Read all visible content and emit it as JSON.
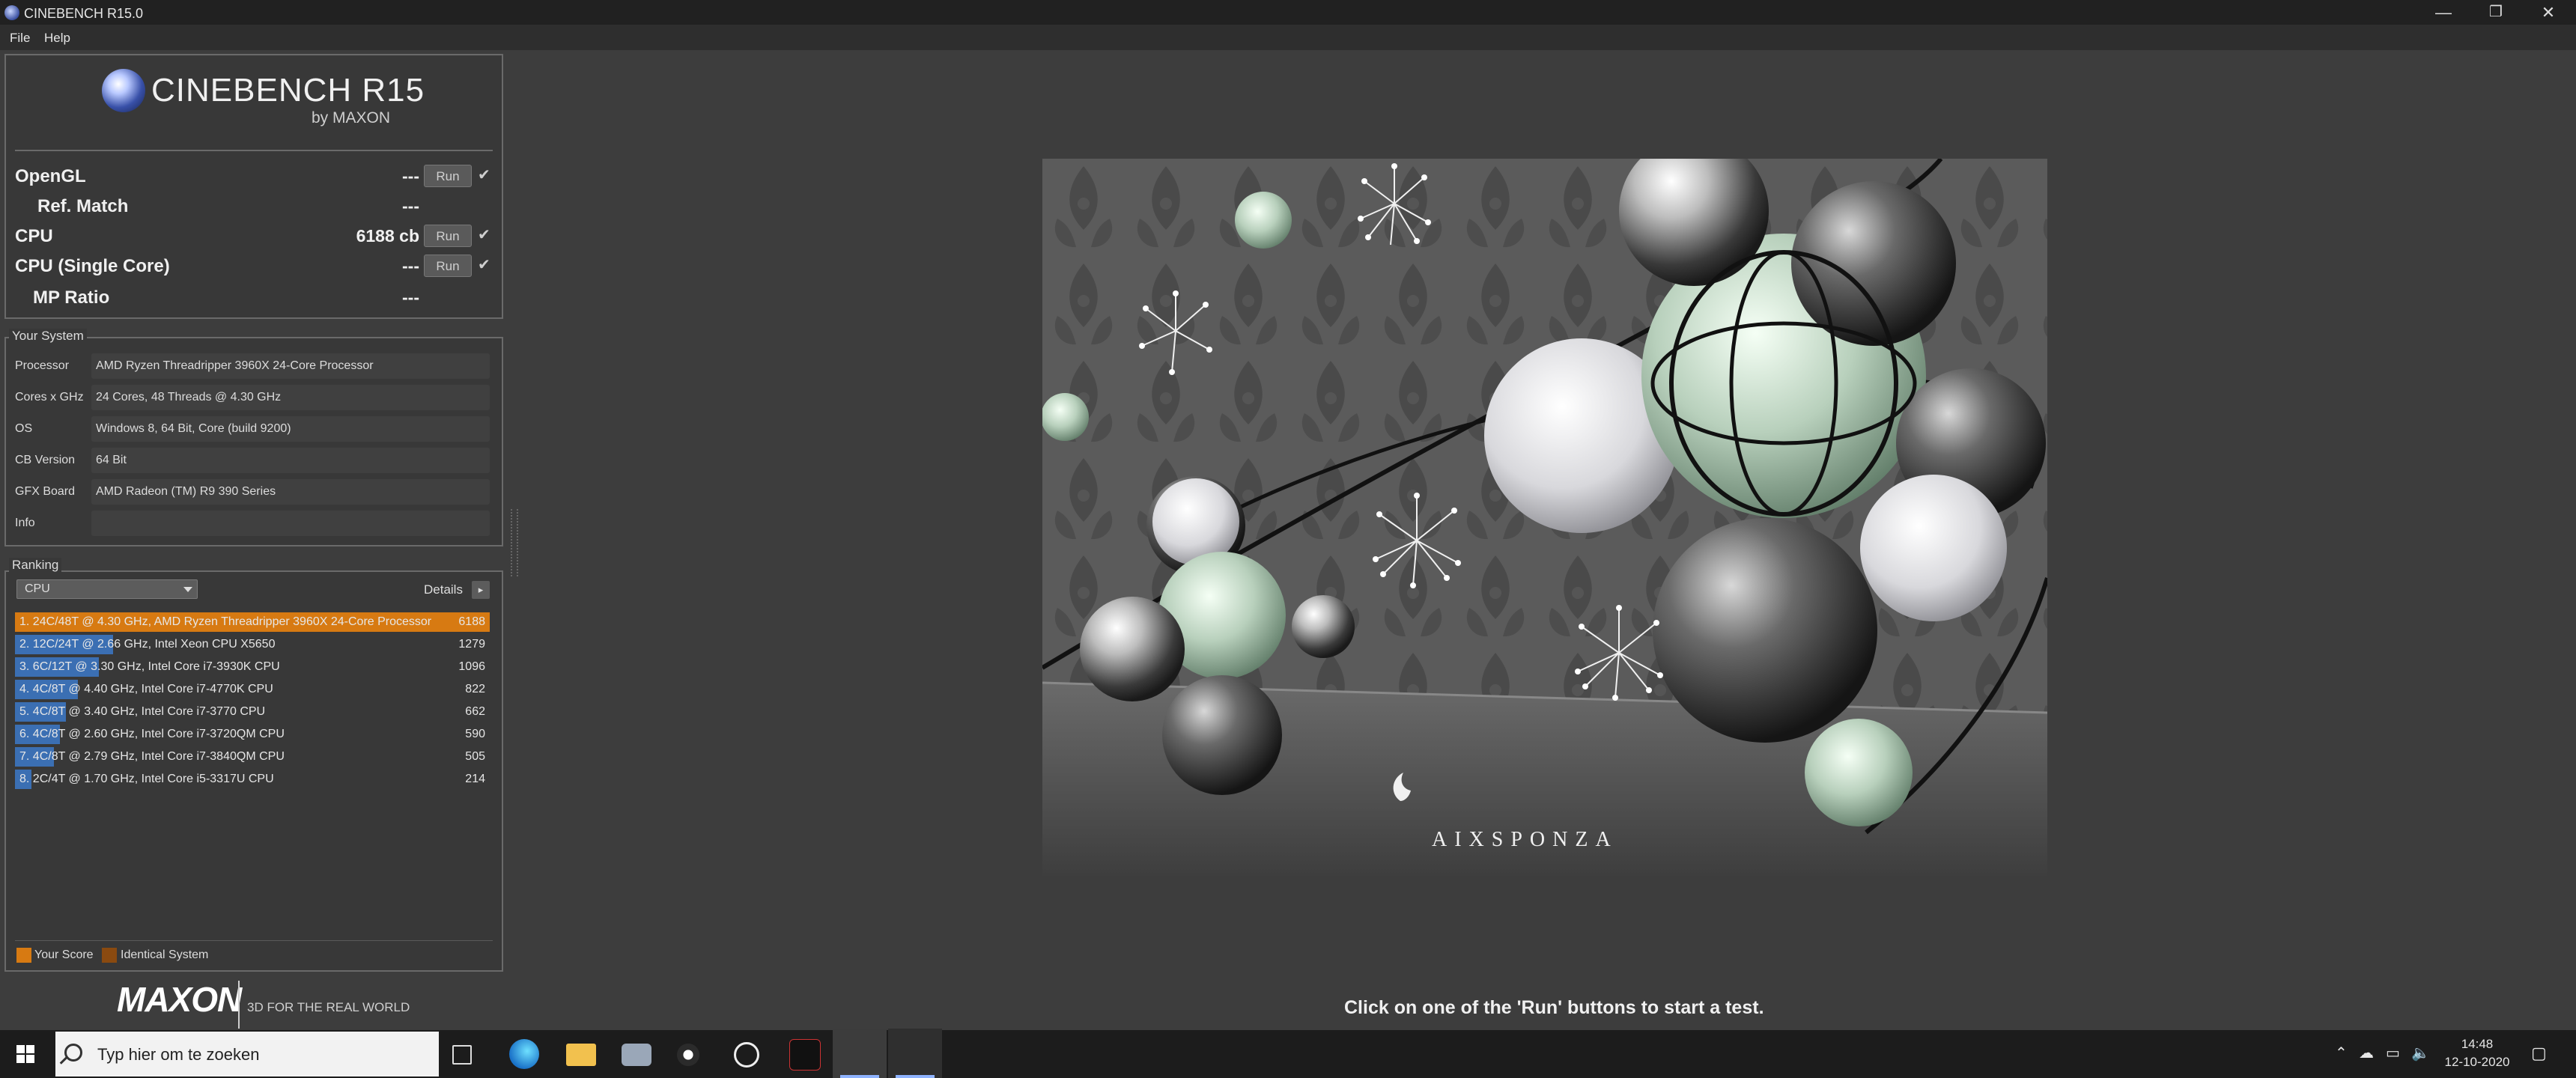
{
  "window": {
    "title": "CINEBENCH R15.0",
    "minimize": "—",
    "restore": "❐",
    "close": "✕"
  },
  "menu": {
    "file": "File",
    "help": "Help"
  },
  "logo": {
    "name": "CINEBENCH R15",
    "sub": "by MAXON"
  },
  "tests": {
    "opengl": {
      "label": "OpenGL",
      "score": "---",
      "run": "Run"
    },
    "refmatch": {
      "label": "Ref. Match",
      "score": "---"
    },
    "cpu": {
      "label": "CPU",
      "score": "6188 cb",
      "run": "Run"
    },
    "single": {
      "label": "CPU (Single Core)",
      "score": "---",
      "run": "Run"
    },
    "mpratio": {
      "label": "MP Ratio",
      "score": "---"
    },
    "check": "✔"
  },
  "system": {
    "title": "Your System",
    "rows": [
      {
        "label": "Processor",
        "value": "AMD Ryzen Threadripper 3960X 24-Core Processor"
      },
      {
        "label": "Cores x GHz",
        "value": "24 Cores, 48 Threads @ 4.30 GHz"
      },
      {
        "label": "OS",
        "value": "Windows 8, 64 Bit, Core (build 9200)"
      },
      {
        "label": "CB Version",
        "value": "64 Bit"
      },
      {
        "label": "GFX Board",
        "value": "AMD Radeon (TM) R9 390 Series"
      },
      {
        "label": "Info",
        "value": ""
      }
    ]
  },
  "ranking": {
    "title": "Ranking",
    "select": "CPU",
    "details": "Details",
    "details_btn": "▸",
    "max_score": 6188,
    "rows": [
      {
        "label": "1. 24C/48T @ 4.30 GHz, AMD Ryzen Threadripper 3960X 24-Core Processor",
        "score": 6188,
        "me": true
      },
      {
        "label": "2. 12C/24T @ 2.66 GHz, Intel Xeon CPU X5650",
        "score": 1279,
        "me": false
      },
      {
        "label": "3. 6C/12T @ 3.30 GHz,  Intel Core i7-3930K CPU",
        "score": 1096,
        "me": false
      },
      {
        "label": "4. 4C/8T @ 4.40 GHz, Intel Core i7-4770K CPU",
        "score": 822,
        "me": false
      },
      {
        "label": "5. 4C/8T @ 3.40 GHz,  Intel Core i7-3770 CPU",
        "score": 662,
        "me": false
      },
      {
        "label": "6. 4C/8T @ 2.60 GHz, Intel Core i7-3720QM CPU",
        "score": 590,
        "me": false
      },
      {
        "label": "7. 4C/8T @ 2.79 GHz,  Intel Core i7-3840QM CPU",
        "score": 505,
        "me": false
      },
      {
        "label": "8. 2C/4T @ 1.70 GHz,  Intel Core i5-3317U CPU",
        "score": 214,
        "me": false
      }
    ],
    "legend": {
      "your_score": "Your Score",
      "identical": "Identical System",
      "your_color": "#d77a12",
      "identical_color": "#8a4a10"
    }
  },
  "footer": {
    "brand": "MAXON",
    "tagline": "3D FOR THE REAL WORLD"
  },
  "render": {
    "watermark": "AIXSPONZA",
    "hint": "Click on one of the 'Run' buttons to start a test."
  },
  "taskbar": {
    "search_placeholder": "Typ hier om te zoeken",
    "time": "14:48",
    "date": "12-10-2020"
  }
}
